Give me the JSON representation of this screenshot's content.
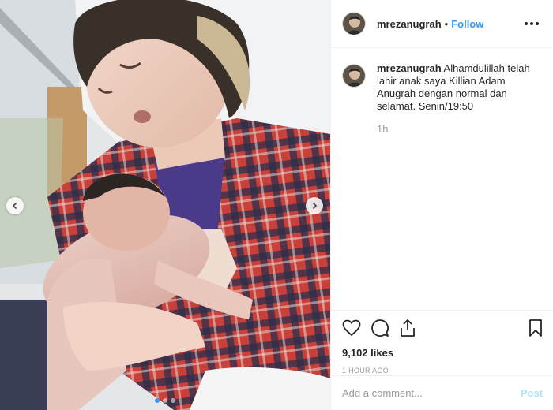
{
  "post": {
    "username": "mrezanugrah",
    "separator": "•",
    "follow_label": "Follow",
    "more_icon": "more-horizontal-icon"
  },
  "caption": {
    "username": "mrezanugrah",
    "text": "Alhamdulillah telah lahir anak saya Killian Adam Anugrah dengan normal dan selamat. Senin/19:50",
    "time": "1h"
  },
  "actions": {
    "icons": [
      "heart-icon",
      "comment-icon",
      "share-icon",
      "bookmark-icon"
    ],
    "likes": "9,102 likes",
    "posted_ago": "1 HOUR AGO"
  },
  "comment_box": {
    "placeholder": "Add a comment...",
    "post_label": "Post"
  },
  "carousel": {
    "slide_count": 3,
    "active_index": 0,
    "accent": "#3897f0"
  },
  "colors": {
    "link": "#3897f0",
    "post_disabled": "#b2dffc",
    "muted": "#999999"
  }
}
